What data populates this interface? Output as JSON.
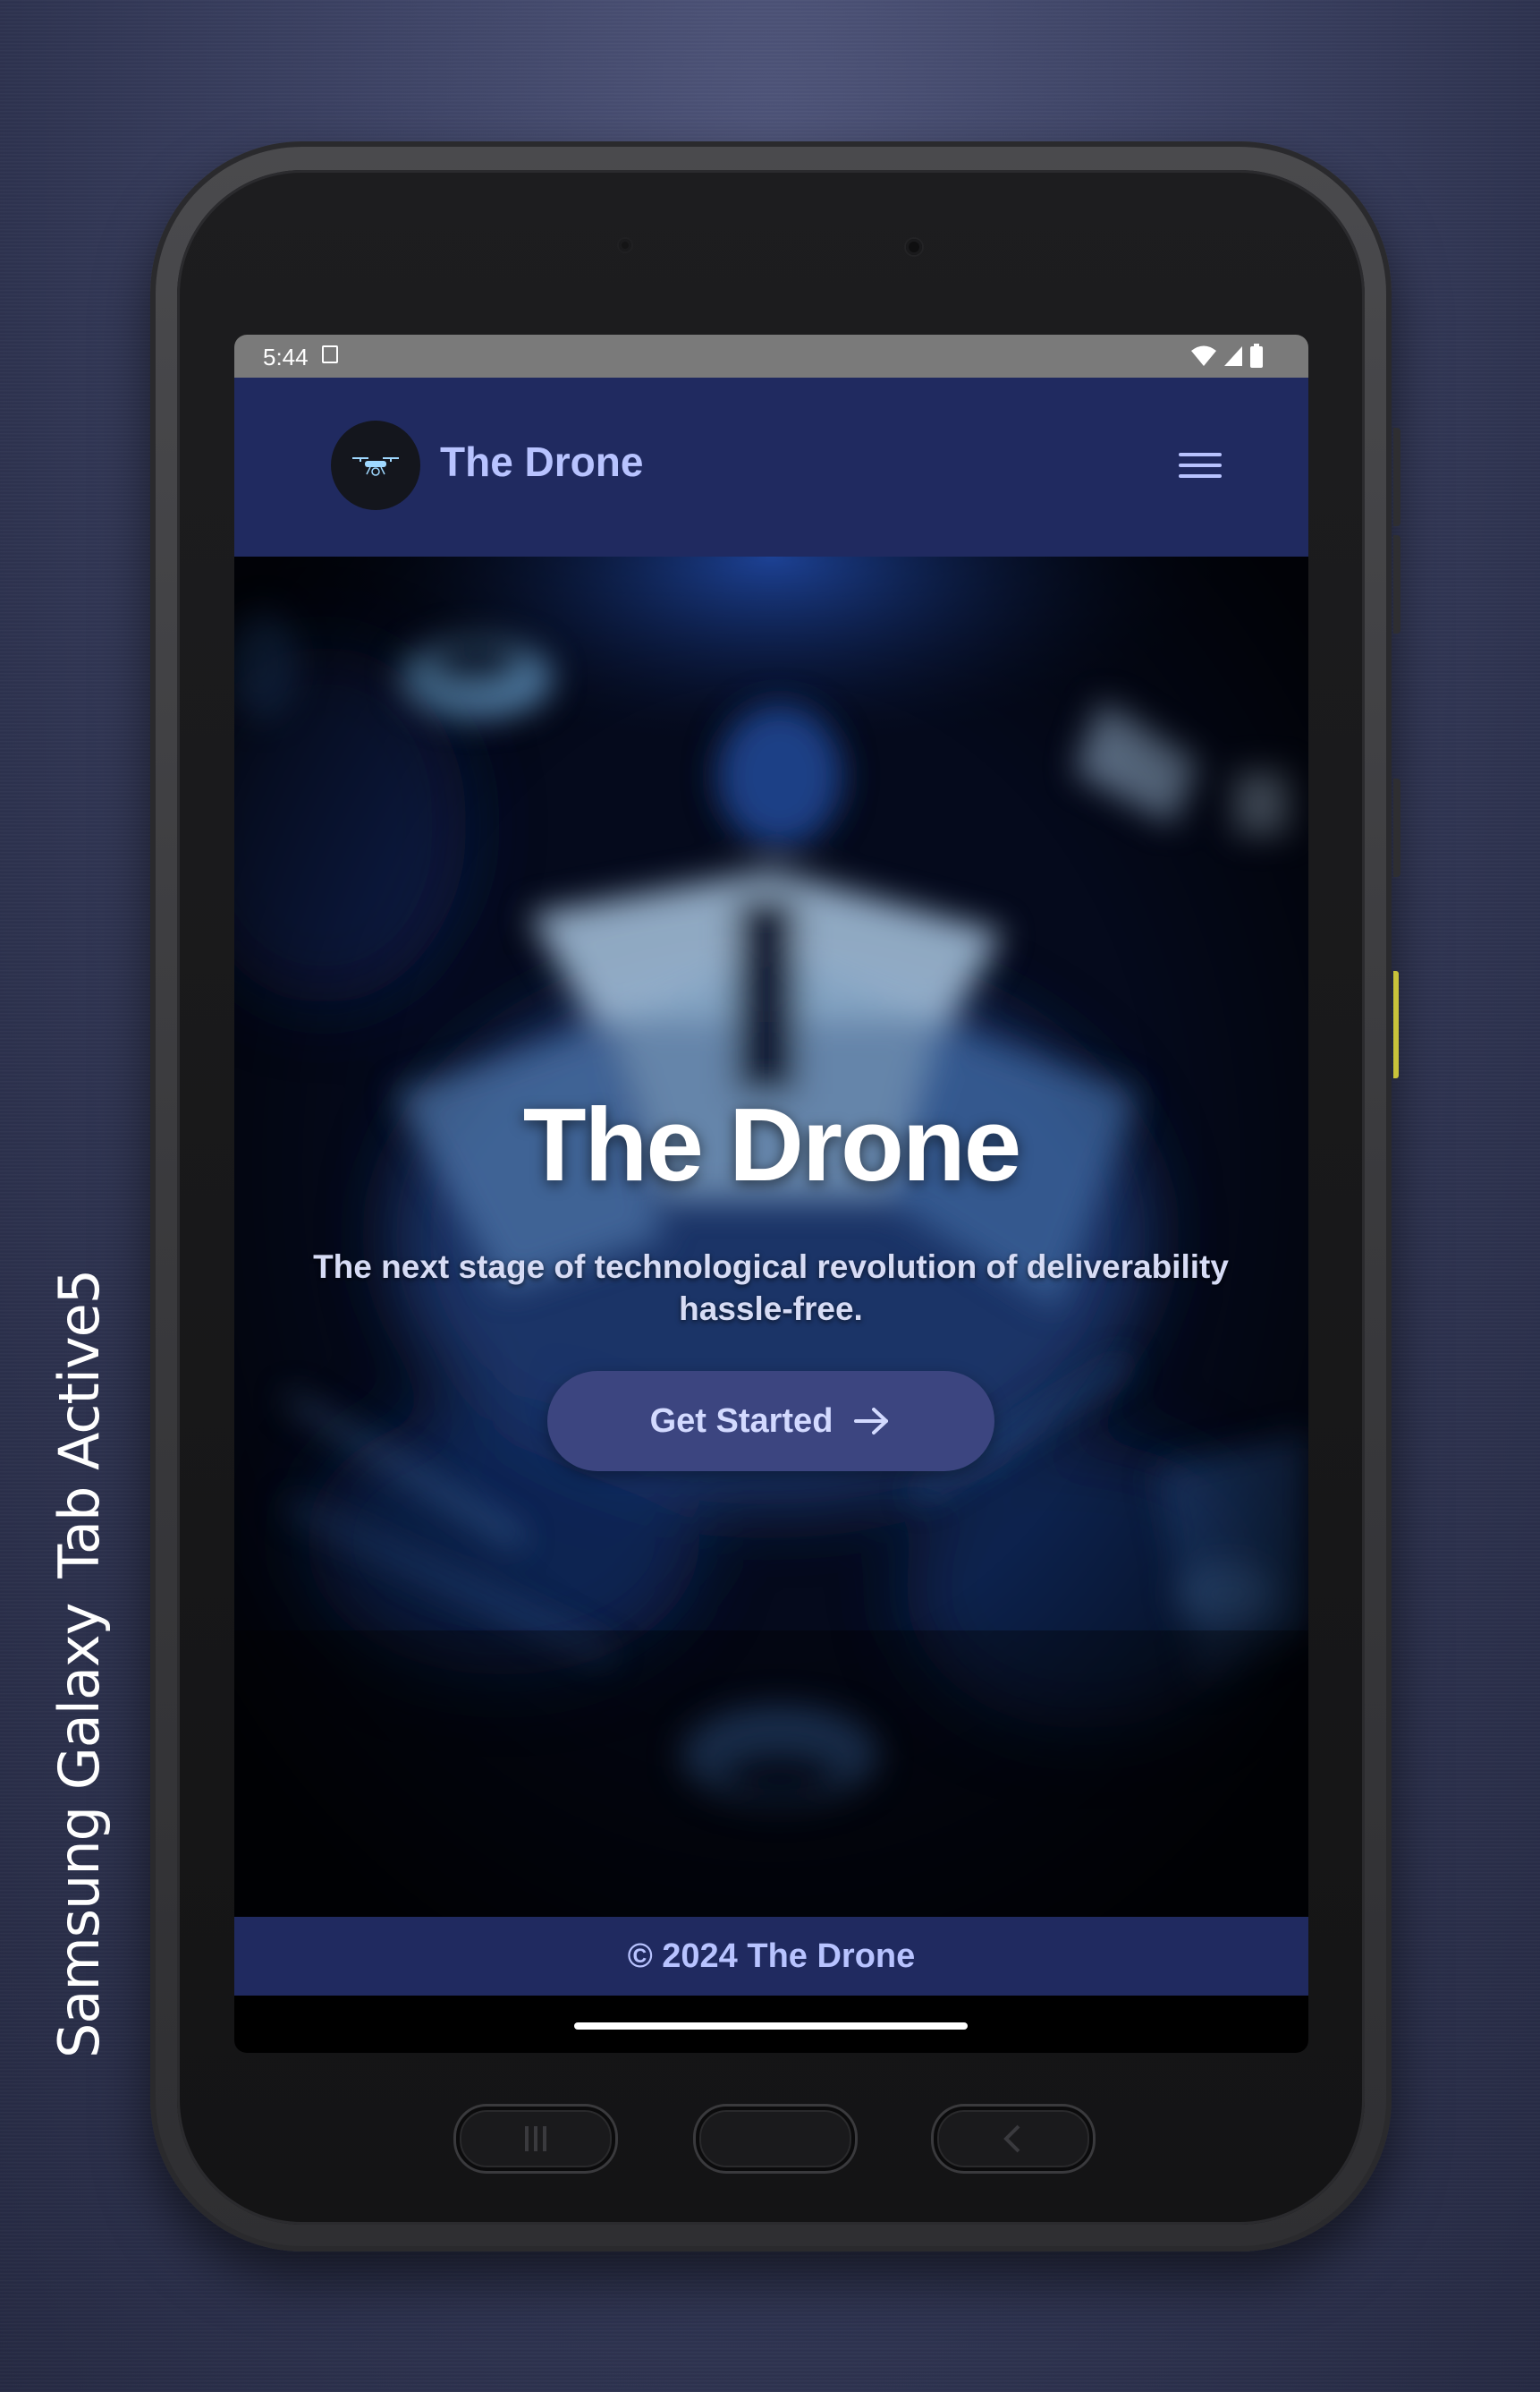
{
  "device": {
    "label_brand": "Samsung Galaxy",
    "label_model": "Tab Active5"
  },
  "status_bar": {
    "time": "5:44",
    "icons": [
      "notification-icon",
      "wifi-icon",
      "signal-icon",
      "battery-icon"
    ]
  },
  "header": {
    "brand_title": "The Drone",
    "logo_icon": "drone-icon",
    "menu_icon": "hamburger-menu-icon"
  },
  "hero": {
    "title": "The Drone",
    "subtitle": "The next stage of technological revolution of deliverability hassle-free.",
    "cta_label": "Get Started",
    "cta_icon": "arrow-right-icon"
  },
  "footer": {
    "copyright": "© 2024 The Drone"
  },
  "hardware_buttons": [
    "recents-icon",
    "home-button",
    "back-icon"
  ],
  "colors": {
    "header_bg": "#202a60",
    "brand_text": "#b8c3ff",
    "cta_bg": "#3c4580",
    "status_bar_bg": "#7a7a7a"
  }
}
